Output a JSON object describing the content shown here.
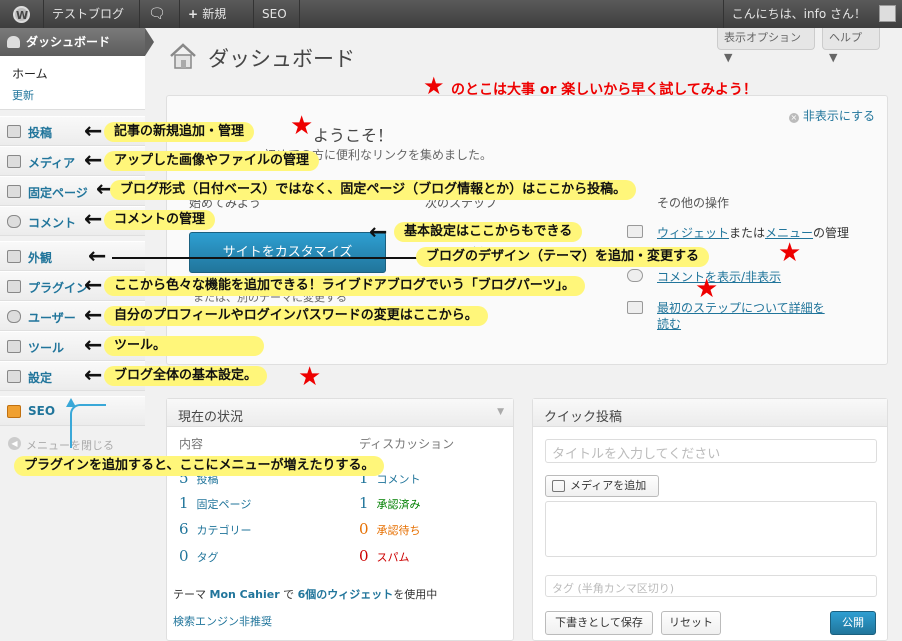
{
  "adminbar": {
    "site": "テストブログ",
    "new": "新規",
    "seo": "SEO",
    "howdy": "こんにちは、info さん！"
  },
  "sidebar": {
    "dashboard": "ダッシュボード",
    "home": "ホーム",
    "update": "更新",
    "items": [
      {
        "label": "投稿",
        "icon": "pin-icon"
      },
      {
        "label": "メディア",
        "icon": "media-icon"
      },
      {
        "label": "固定ページ",
        "icon": "page-icon"
      },
      {
        "label": "コメント",
        "icon": "comment-icon"
      },
      {
        "label": "外観",
        "icon": "appearance-icon"
      },
      {
        "label": "プラグイン",
        "icon": "plugin-icon"
      },
      {
        "label": "ユーザー",
        "icon": "users-icon"
      },
      {
        "label": "ツール",
        "icon": "tools-icon"
      },
      {
        "label": "設定",
        "icon": "settings-icon"
      },
      {
        "label": "SEO",
        "icon": "seo-icon"
      }
    ],
    "collapse": "メニューを閉じる"
  },
  "header": {
    "title": "ダッシュボード",
    "screen_options": "表示オプション ▼",
    "help": "ヘルプ ▼"
  },
  "welcome": {
    "title": "ようこそ！",
    "desc": "初めての方に便利なリンクを集めました。",
    "dismiss": "非表示にする",
    "customize_button": "サイトをカスタマイズ",
    "col1_head": "始めてみよう",
    "col2_head": "次のステップ",
    "col3_head": "その他の操作",
    "or_text": "または、別のテーマに変更する",
    "mid_link": "追加",
    "widgets_link": "ウィジェット",
    "or_word": "または",
    "menus_link": "メニュー",
    "manage_word": "の管理",
    "comments_link": "コメントを表示/非表示",
    "learn_more": "最初のステップについて詳細を",
    "read": "読む"
  },
  "now": {
    "title": "現在の状況",
    "col_content": "内容",
    "col_discussion": "ディスカッション",
    "content_rows": [
      {
        "num": "5",
        "label": "投稿"
      },
      {
        "num": "1",
        "label": "固定ページ"
      },
      {
        "num": "6",
        "label": "カテゴリー"
      },
      {
        "num": "0",
        "label": "タグ"
      }
    ],
    "discussion_rows": [
      {
        "num": "1",
        "label": "コメント",
        "color": "#21759b"
      },
      {
        "num": "1",
        "label": "承認済み",
        "color": "#008000"
      },
      {
        "num": "0",
        "label": "承認待ち",
        "color": "#e66f00"
      },
      {
        "num": "0",
        "label": "スパム",
        "color": "#cc0000"
      }
    ],
    "theme_prefix": "テーマ",
    "theme_name": "Mon Cahier",
    "theme_mid": "で",
    "widgets": "6個のウィジェット",
    "theme_suffix": "を使用中",
    "search_engine": "検索エンジン非推奨"
  },
  "quick": {
    "title": "クイック投稿",
    "title_placeholder": "タイトルを入力してください",
    "add_media": "メディアを追加",
    "tags_placeholder": "タグ (半角カンマ区切り)",
    "save_draft": "下書きとして保存",
    "reset": "リセット",
    "publish": "公開"
  },
  "annotations": {
    "header_note": "のとこは大事 or 楽しいから早く試してみよう！",
    "posts": "記事の新規追加・管理",
    "media": "アップした画像やファイルの管理",
    "pages": "ブログ形式（日付ベース）ではなく、固定ページ（ブログ情報とか）はここから投稿。",
    "comments": "コメントの管理",
    "settings_here": "基本設定はここからもできる",
    "appearance": "ブログのデザイン（テーマ）を追加・変更する",
    "plugins": "ここから色々な機能を追加できる！ライブドアブログでいう「ブログパーツ」。",
    "users": "自分のプロフィールやログインパスワードの変更はここから。",
    "tools": "ツール。",
    "settings": "ブログ全体の基本設定。",
    "plugin_menu": "プラグインを追加すると、ここにメニューが増えたりする。"
  },
  "colors": {
    "accent": "#21759b",
    "star": "#ee0000",
    "note_bg": "#fff67a"
  }
}
